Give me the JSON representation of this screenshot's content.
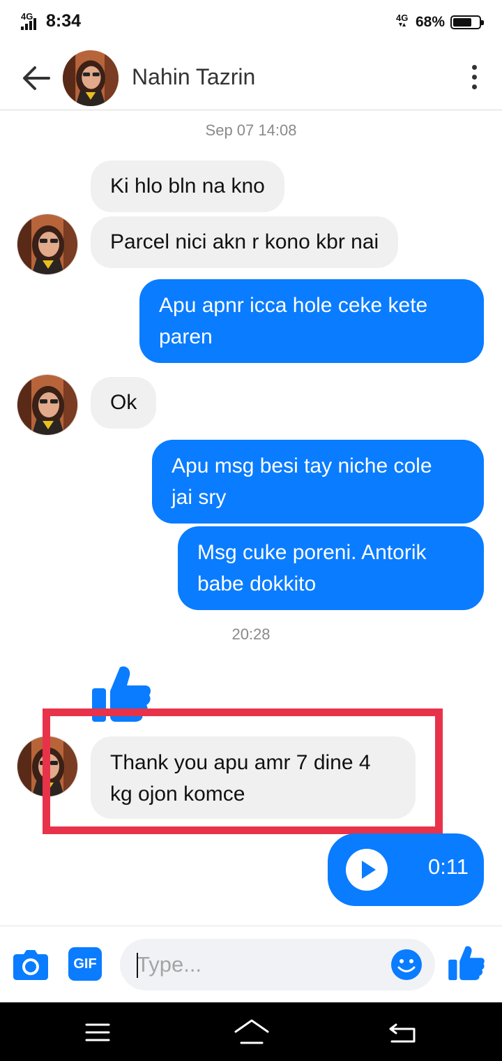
{
  "status_bar": {
    "network_left": "4G",
    "time": "8:34",
    "network_right": "4G",
    "battery_text": "68%",
    "battery_level": 0.68
  },
  "header": {
    "contact_name": "Nahin Tazrin",
    "back_icon": "arrow-left-icon",
    "more_icon": "more-vertical-icon"
  },
  "timestamps": [
    "Sep 07 14:08",
    "20:28"
  ],
  "messages": [
    {
      "direction": "incoming",
      "text": "Ki hlo bln na kno"
    },
    {
      "direction": "incoming",
      "text": "Parcel nici akn r kono kbr nai"
    },
    {
      "direction": "outgoing",
      "lines": [
        "Apu apnr icca hole ceke  kete",
        "paren"
      ]
    },
    {
      "direction": "incoming",
      "text": "Ok"
    },
    {
      "direction": "outgoing",
      "lines": [
        "Apu msg besi tay niche cole",
        "jai sry"
      ]
    },
    {
      "direction": "outgoing",
      "lines": [
        "Msg cuke poreni. Antorik",
        "babe dokkito"
      ]
    },
    {
      "direction": "incoming",
      "type": "like-sticker",
      "icon": "thumbs-up-icon"
    },
    {
      "direction": "incoming",
      "lines": [
        "Thank you apu amr 7 dine 4",
        "kg ojon komce"
      ],
      "highlighted": true
    },
    {
      "direction": "outgoing",
      "type": "voice",
      "duration": "0:11"
    }
  ],
  "composer": {
    "camera_icon": "camera-icon",
    "gif_label": "GIF",
    "placeholder": "Type...",
    "emoji_icon": "smiley-icon",
    "like_icon": "thumbs-up-icon"
  },
  "nav_bar": {
    "icons": [
      "menu-icon",
      "home-icon",
      "back-icon"
    ]
  },
  "colors": {
    "messenger_blue": "#0a7cff",
    "incoming_bubble": "#f0f0f0",
    "highlight_red": "#e8324a"
  }
}
